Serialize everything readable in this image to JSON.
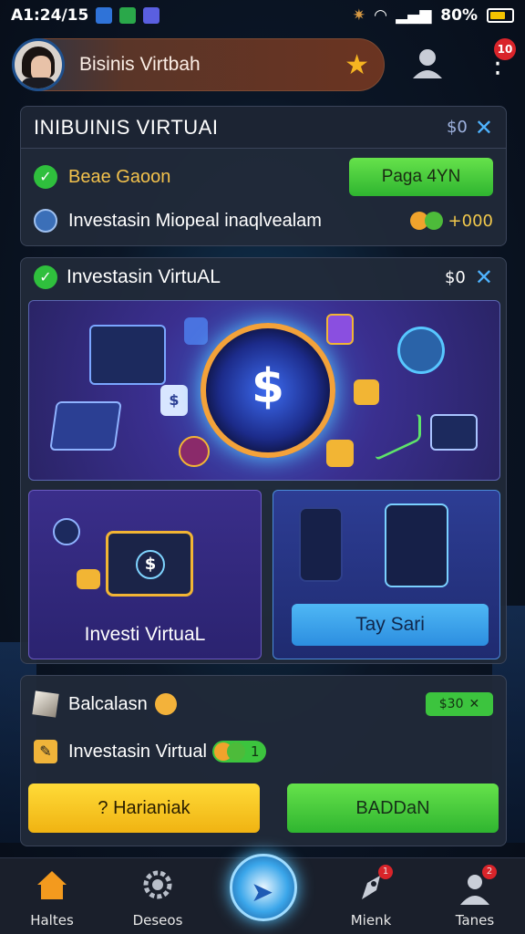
{
  "status_bar": {
    "time": "A1:24/15",
    "battery": "80%"
  },
  "header": {
    "title": "Bisinis Virtbah",
    "menu_badge": "10"
  },
  "panel1": {
    "title": "INIBUINIS VIRTUAI",
    "header_value": "$0",
    "row1_label": "Beae Gaoon",
    "row1_button": "Paga 4YN",
    "row2_label": "Investasin Miopeal inaqlvealam",
    "row2_value": "+000"
  },
  "panel2": {
    "title": "Investasin VirtuAL",
    "header_value": "$0",
    "left_label": "Investi VirtuaL",
    "right_button": "Tay Sari"
  },
  "panel3": {
    "row1_label": "Balcalasn",
    "row1_badge": "$30",
    "row2_label": "Investasin Virtual",
    "row2_badge": "1",
    "btn_yellow": "? Harianiak",
    "btn_green": "BADDaN"
  },
  "nav": [
    {
      "label": "Haltes",
      "icon": "home-icon"
    },
    {
      "label": "Deseos",
      "icon": "gear-icon"
    },
    {
      "label": "Mienk",
      "icon": "rocket-icon",
      "badge": "1"
    },
    {
      "label": "Tanes",
      "icon": "user-icon",
      "badge": "2"
    }
  ],
  "colors": {
    "accent_green": "#3cc43e",
    "accent_yellow": "#f0b312",
    "accent_blue": "#2c8ee0",
    "background": "#0b1626"
  }
}
